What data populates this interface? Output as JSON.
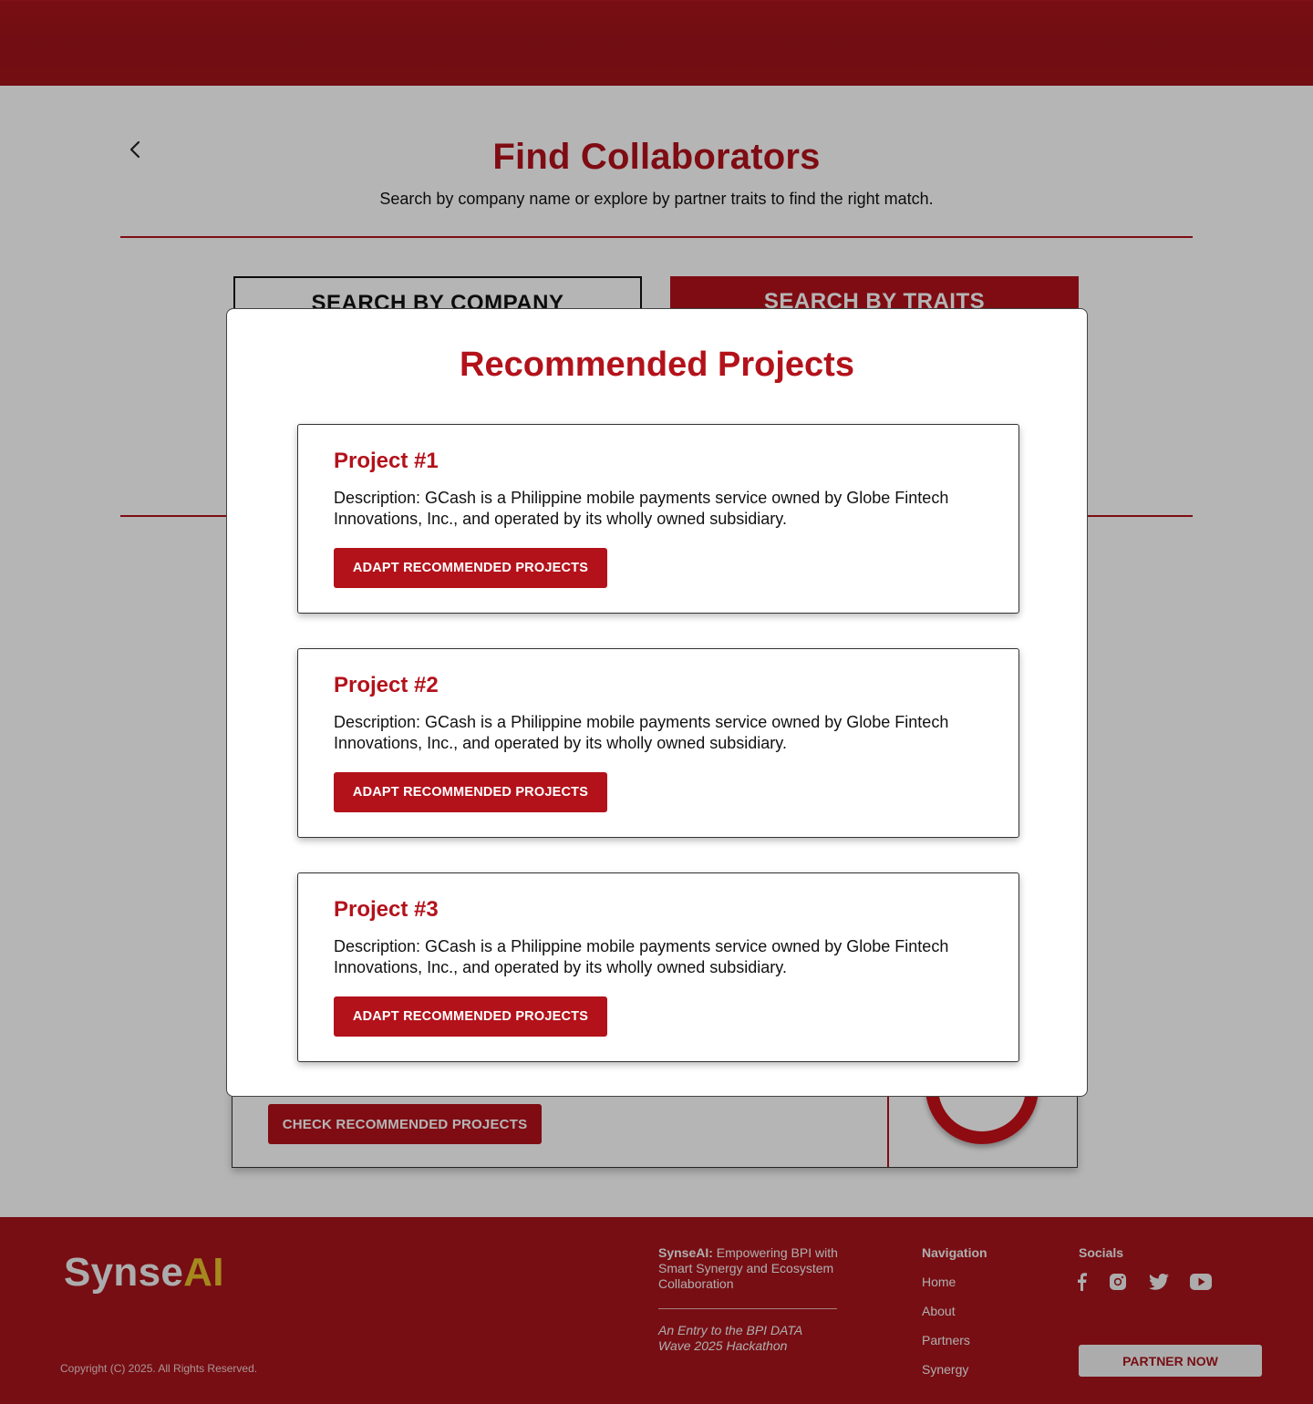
{
  "page": {
    "title": "Find Collaborators",
    "subtitle": "Search by company name or explore by partner traits to find the right match."
  },
  "tabs": {
    "company": "SEARCH BY COMPANY",
    "traits": "SEARCH BY TRAITS"
  },
  "result_card": {
    "check_button": "CHECK RECOMMENDED PROJECTS"
  },
  "modal": {
    "title": "Recommended Projects",
    "projects": [
      {
        "title": "Project #1",
        "description": "Description: GCash is a Philippine mobile payments service owned by Globe Fintech Innovations, Inc., and operated by its wholly owned subsidiary.",
        "button": "ADAPT RECOMMENDED PROJECTS"
      },
      {
        "title": "Project #2",
        "description": "Description: GCash is a Philippine mobile payments service owned by Globe Fintech Innovations, Inc., and operated by its wholly owned subsidiary.",
        "button": "ADAPT RECOMMENDED PROJECTS"
      },
      {
        "title": "Project #3",
        "description": "Description: GCash is a Philippine mobile payments service owned by Globe Fintech Innovations, Inc., and operated by its wholly owned subsidiary.",
        "button": "ADAPT RECOMMENDED PROJECTS"
      }
    ]
  },
  "footer": {
    "logo_part1": "Synse",
    "logo_part2": "AI",
    "tagline_brand": "SynseAI:",
    "tagline_text": " Empowering BPI with Smart Synergy and Ecosystem Collaboration",
    "entry": "An Entry to the BPI DATA Wave 2025 Hackathon",
    "copyright": "Copyright (C) 2025. All Rights Reserved.",
    "navigation_heading": "Navigation",
    "nav": {
      "home": "Home",
      "about": "About",
      "partners": "Partners",
      "synergy": "Synergy"
    },
    "socials_heading": "Socials",
    "social_icons": [
      "facebook-icon",
      "instagram-icon",
      "twitter-icon",
      "youtube-icon"
    ],
    "partner_button": "PARTNER NOW"
  },
  "colors": {
    "brand_red": "#b3121b",
    "header_red": "#a0141b",
    "logo_gold": "#e9c22b"
  }
}
